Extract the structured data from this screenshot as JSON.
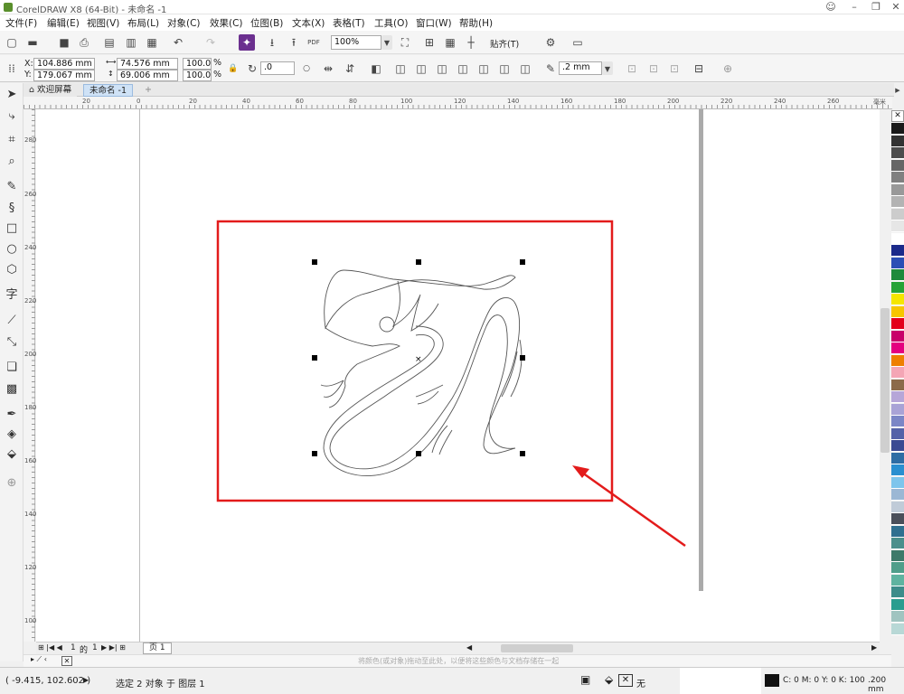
{
  "window": {
    "title": "CorelDRAW X8 (64-Bit) - 未命名 -1",
    "min": "–",
    "restore": "❐",
    "close": "✕"
  },
  "menu": [
    "文件(F)",
    "编辑(E)",
    "视图(V)",
    "布局(L)",
    "对象(C)",
    "效果(C)",
    "位图(B)",
    "文本(X)",
    "表格(T)",
    "工具(O)",
    "窗口(W)",
    "帮助(H)"
  ],
  "toolbar1": {
    "zoom": "100%",
    "snap_label": "贴齐(T)",
    "pdf_label": "PDF"
  },
  "toolbar2": {
    "x_label": "X:",
    "x_value": "104.886 mm",
    "y_label": "Y:",
    "y_value": "179.067 mm",
    "w_value": "74.576 mm",
    "h_value": "69.006 mm",
    "sx_value": "100.0",
    "sy_value": "100.0",
    "pct": "%",
    "angle_value": ".0",
    "outline_value": ".2 mm"
  },
  "tabs": {
    "home_icon": "home-icon",
    "welcome": "欢迎屏幕",
    "doc": "未命名 -1",
    "add": "+"
  },
  "ruler": {
    "h_ticks": [
      "20",
      "0",
      "20",
      "40",
      "60",
      "80",
      "100",
      "120",
      "140",
      "160",
      "180",
      "200",
      "220",
      "240",
      "260"
    ],
    "units": "毫米",
    "v_ticks": [
      "280",
      "260",
      "240",
      "220",
      "200",
      "180",
      "160",
      "140",
      "120",
      "100"
    ]
  },
  "pagenav": {
    "current": "1",
    "of_label": "的",
    "total": "1",
    "page_tab": "页 1"
  },
  "hint": "将颜色(或对象)拖动至此处，以便将这些颜色与文档存储在一起",
  "status": {
    "coords": "( -9.415, 102.602 )",
    "selection": "选定 2 对象 于 图层 1",
    "fill_none": "无",
    "color_info": "C: 0 M: 0 Y: 0 K: 100",
    ".2": ".200 mm"
  },
  "palette": [
    "#1a1a1a",
    "#333333",
    "#4d4d4d",
    "#666666",
    "#808080",
    "#999999",
    "#b3b3b3",
    "#cccccc",
    "#e6e6e6",
    "#ffffff",
    "#1b2a8a",
    "#2b4fb5",
    "#1f8a3c",
    "#26a337",
    "#f5e600",
    "#f7c600",
    "#e3001b",
    "#c8006a",
    "#e4007f",
    "#ee7f00",
    "#f4a6b5",
    "#8c6a4a",
    "#b6a6d8",
    "#a9a3d6",
    "#7b86c6",
    "#5462a8",
    "#3a4a92",
    "#2e6da4",
    "#2a8fd0",
    "#7ec5ec",
    "#9bb7d4",
    "#c0cbd8",
    "#4a4f5a",
    "#2f6f8f",
    "#4b8f8c",
    "#3e7a6a",
    "#4f9e8a",
    "#5fb3a0",
    "#3d8c8a",
    "#2a9d8f",
    "#a0c4c0",
    "#b8d8d6"
  ],
  "colors": {
    "highlight": "#e31b1b",
    "accent": "#1a6fd1"
  }
}
